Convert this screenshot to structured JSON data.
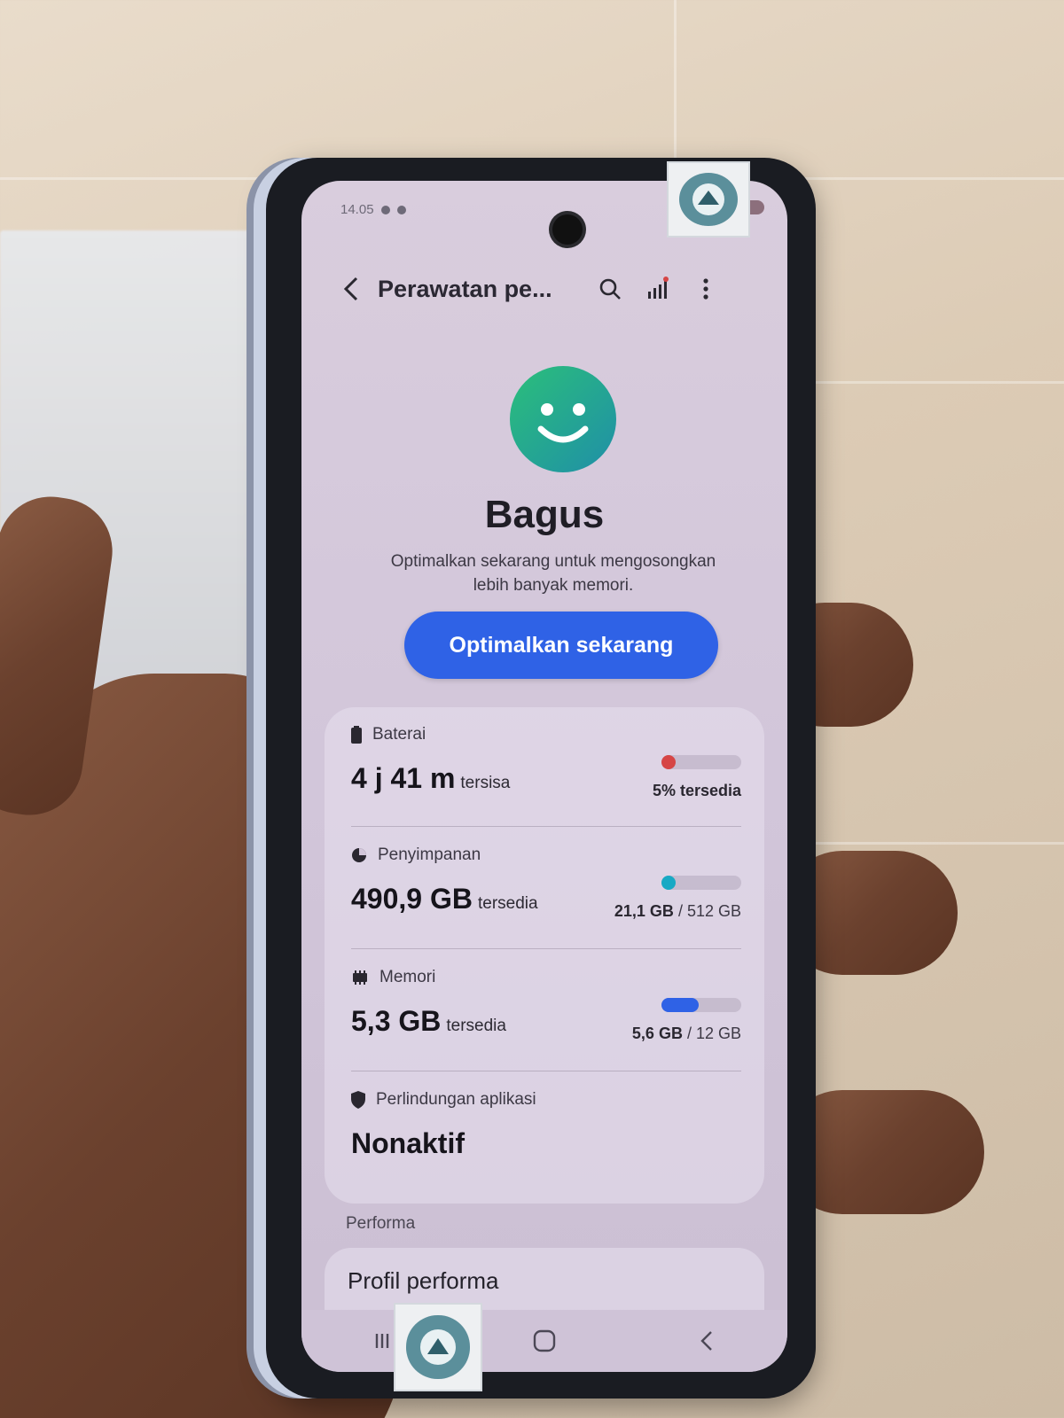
{
  "status_bar": {
    "time": "14.05"
  },
  "toolbar": {
    "title": "Perawatan pe..."
  },
  "device_status": {
    "title": "Bagus",
    "description": "Optimalkan sekarang untuk mengosongkan lebih banyak memori.",
    "optimize_button": "Optimalkan sekarang"
  },
  "battery": {
    "label": "Baterai",
    "value": "4 j 41 m",
    "unit": "tersisa",
    "side": "5% tersedia",
    "level": 0.05,
    "bar_color": "#d64545"
  },
  "storage": {
    "label": "Penyimpanan",
    "value": "490,9 GB",
    "unit": "tersedia",
    "used": "21,1 GB",
    "total": "/ 512 GB",
    "level": 0.04,
    "bar_color": "#17a9c4"
  },
  "memory": {
    "label": "Memori",
    "value": "5,3 GB",
    "unit": "tersedia",
    "used": "5,6 GB",
    "total": "/ 12 GB",
    "level": 0.47,
    "bar_color": "#2f62e6"
  },
  "app_protection": {
    "label": "Perlindungan aplikasi",
    "value": "Nonaktif"
  },
  "performance": {
    "section_label": "Performa",
    "profile_label": "Profil performa"
  },
  "icons": {
    "back": "back-chevron-icon",
    "search": "search-icon",
    "stats": "signal-bars-icon",
    "more": "more-vert-icon",
    "face": "smiley-face-icon",
    "battery": "battery-icon",
    "storage": "storage-pie-icon",
    "memory": "memory-chip-icon",
    "shield": "shield-icon"
  },
  "colors": {
    "accent": "#2f62e6",
    "face_gradient_start": "#1f9aa0",
    "face_gradient_end": "#2bbf7a"
  }
}
